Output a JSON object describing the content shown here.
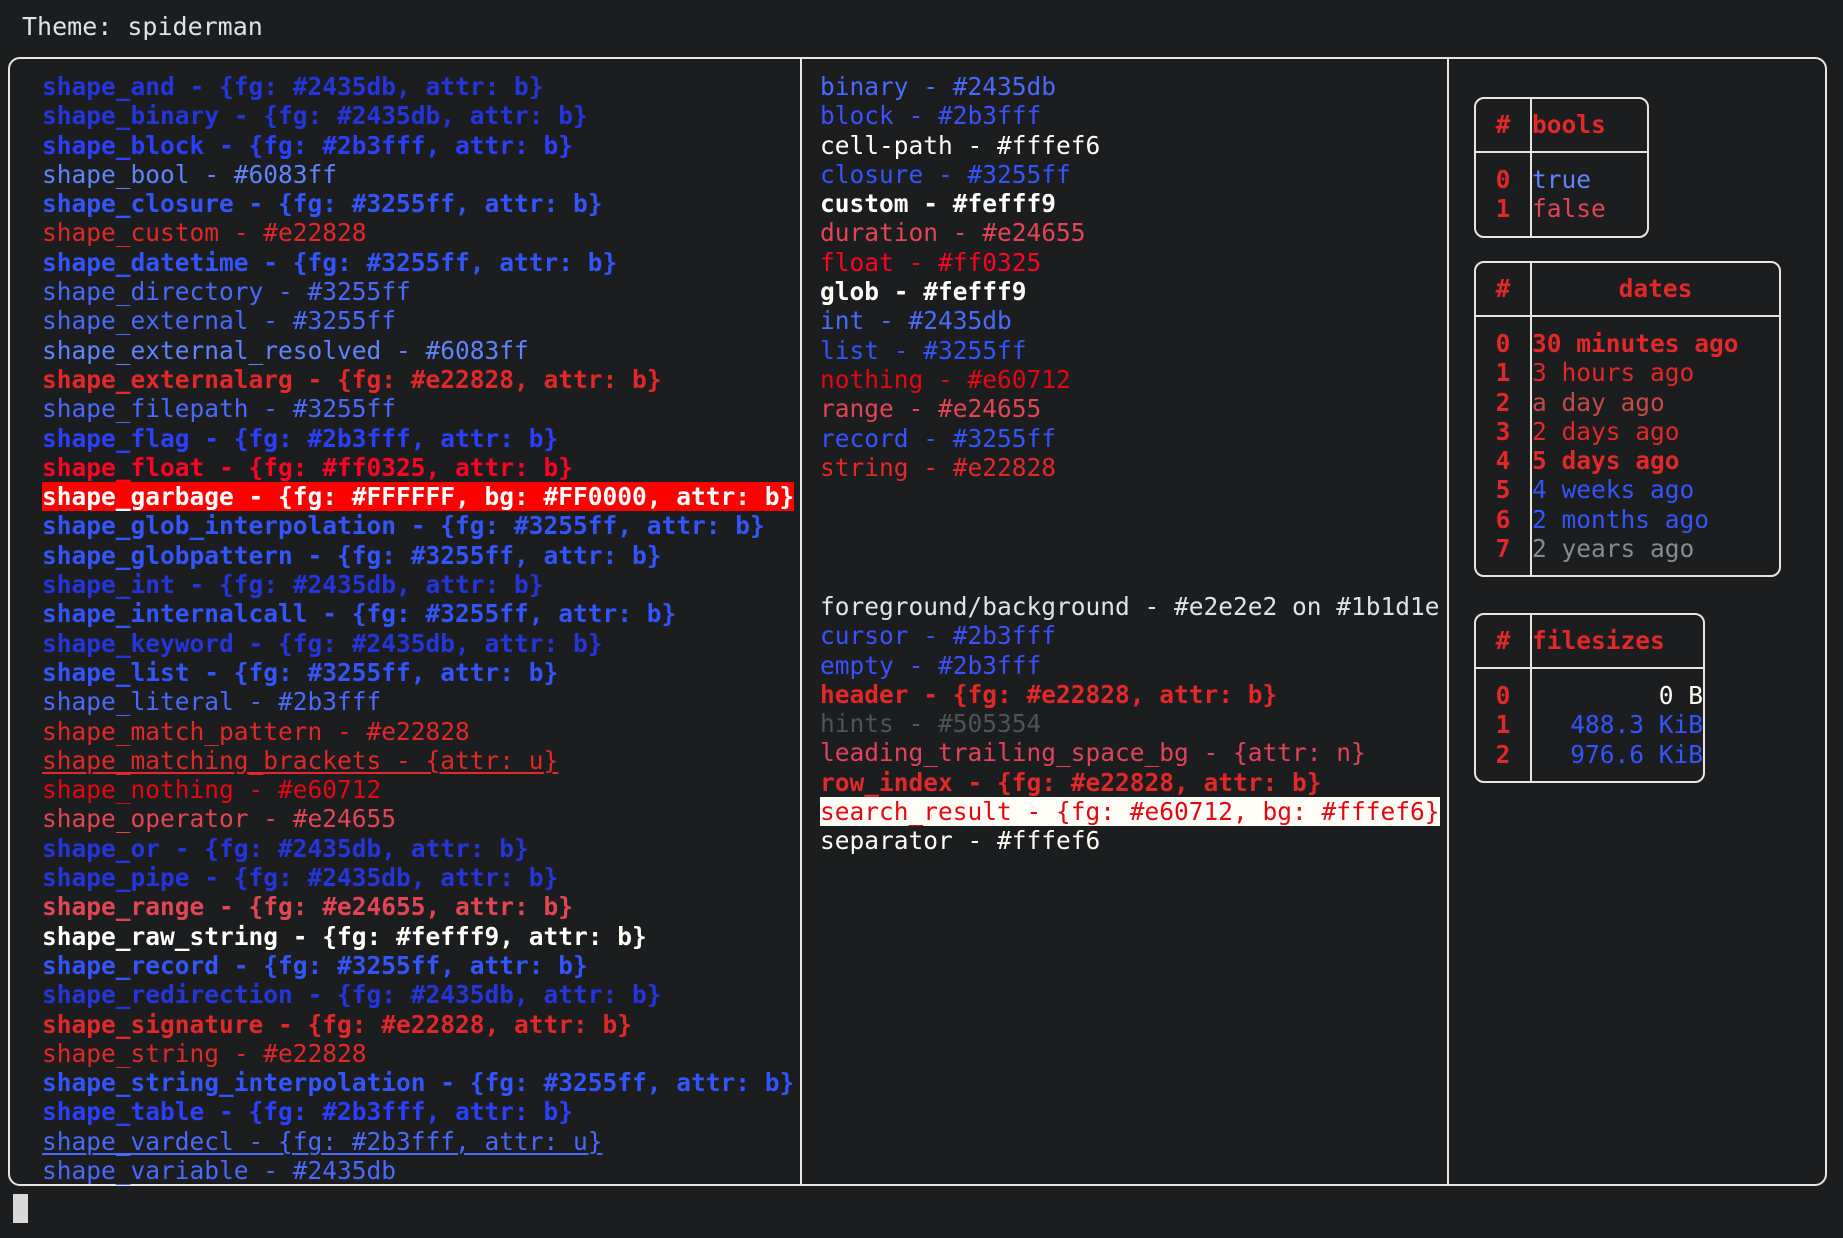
{
  "header": {
    "theme_label": "Theme: spiderman"
  },
  "palette": {
    "background": "#1b1d1e",
    "foreground": "#e2e2e2",
    "border": "#e8e6df",
    "blue_dark": "#2435db",
    "blue_bright": "#2b3fff",
    "blue_mid": "#3255ff",
    "blue_light": "#6083ff",
    "red": "#e22828",
    "red_bright": "#ff0325",
    "red_pure": "#e60712",
    "red_soft": "#e24655",
    "cream": "#fefff9",
    "cream2": "#fffef6",
    "grey": "#505354",
    "highlight_bg": "#ff0000",
    "highlight_fg": "#ffffff"
  },
  "shapes": [
    {
      "text": "shape_and - {fg: #2435db, attr: b}",
      "fg": "#2435db",
      "bold": true,
      "underline": false
    },
    {
      "text": "shape_binary - {fg: #2435db, attr: b}",
      "fg": "#2435db",
      "bold": true,
      "underline": false
    },
    {
      "text": "shape_block - {fg: #2b3fff, attr: b}",
      "fg": "#2b3fff",
      "bold": true,
      "underline": false
    },
    {
      "text": "shape_bool - #6083ff",
      "fg": "#6083ff",
      "bold": false,
      "underline": false
    },
    {
      "text": "shape_closure - {fg: #3255ff, attr: b}",
      "fg": "#3255ff",
      "bold": true,
      "underline": false
    },
    {
      "text": "shape_custom - #e22828",
      "fg": "#e22828",
      "bold": false,
      "underline": false
    },
    {
      "text": "shape_datetime - {fg: #3255ff, attr: b}",
      "fg": "#3255ff",
      "bold": true,
      "underline": false
    },
    {
      "text": "shape_directory - #3255ff",
      "fg": "#4a6aff",
      "bold": false,
      "underline": false
    },
    {
      "text": "shape_external - #3255ff",
      "fg": "#4a6aff",
      "bold": false,
      "underline": false
    },
    {
      "text": "shape_external_resolved - #6083ff",
      "fg": "#6083ff",
      "bold": false,
      "underline": false
    },
    {
      "text": "shape_externalarg - {fg: #e22828, attr: b}",
      "fg": "#e22828",
      "bold": true,
      "underline": false
    },
    {
      "text": "shape_filepath - #3255ff",
      "fg": "#4a6aff",
      "bold": false,
      "underline": false
    },
    {
      "text": "shape_flag - {fg: #2b3fff, attr: b}",
      "fg": "#2b3fff",
      "bold": true,
      "underline": false
    },
    {
      "text": "shape_float - {fg: #ff0325, attr: b}",
      "fg": "#ff0325",
      "bold": true,
      "underline": false
    },
    {
      "text": "shape_garbage - {fg: #FFFFFF, bg: #FF0000, attr: b}",
      "fg": "#ffffff",
      "bg": "#ff0000",
      "bold": true,
      "underline": false
    },
    {
      "text": "shape_glob_interpolation - {fg: #3255ff, attr: b}",
      "fg": "#3255ff",
      "bold": true,
      "underline": false
    },
    {
      "text": "shape_globpattern - {fg: #3255ff, attr: b}",
      "fg": "#3255ff",
      "bold": true,
      "underline": false
    },
    {
      "text": "shape_int - {fg: #2435db, attr: b}",
      "fg": "#2435db",
      "bold": true,
      "underline": false
    },
    {
      "text": "shape_internalcall - {fg: #3255ff, attr: b}",
      "fg": "#3255ff",
      "bold": true,
      "underline": false
    },
    {
      "text": "shape_keyword - {fg: #2435db, attr: b}",
      "fg": "#2435db",
      "bold": true,
      "underline": false
    },
    {
      "text": "shape_list - {fg: #3255ff, attr: b}",
      "fg": "#3255ff",
      "bold": true,
      "underline": false
    },
    {
      "text": "shape_literal - #2b3fff",
      "fg": "#4a6aff",
      "bold": false,
      "underline": false
    },
    {
      "text": "shape_match_pattern - #e22828",
      "fg": "#e22828",
      "bold": false,
      "underline": false
    },
    {
      "text": "shape_matching_brackets - {attr: u}",
      "fg": "#e22828",
      "bold": false,
      "underline": true
    },
    {
      "text": "shape_nothing - #e60712",
      "fg": "#e60712",
      "bold": false,
      "underline": false
    },
    {
      "text": "shape_operator - #e24655",
      "fg": "#e24655",
      "bold": false,
      "underline": false
    },
    {
      "text": "shape_or - {fg: #2435db, attr: b}",
      "fg": "#2435db",
      "bold": true,
      "underline": false
    },
    {
      "text": "shape_pipe - {fg: #2435db, attr: b}",
      "fg": "#2435db",
      "bold": true,
      "underline": false
    },
    {
      "text": "shape_range - {fg: #e24655, attr: b}",
      "fg": "#e24655",
      "bold": true,
      "underline": false
    },
    {
      "text": "shape_raw_string - {fg: #fefff9, attr: b}",
      "fg": "#fefff9",
      "bold": true,
      "underline": false
    },
    {
      "text": "shape_record - {fg: #3255ff, attr: b}",
      "fg": "#3255ff",
      "bold": true,
      "underline": false
    },
    {
      "text": "shape_redirection - {fg: #2435db, attr: b}",
      "fg": "#2435db",
      "bold": true,
      "underline": false
    },
    {
      "text": "shape_signature - {fg: #e22828, attr: b}",
      "fg": "#e22828",
      "bold": true,
      "underline": false
    },
    {
      "text": "shape_string - #e22828",
      "fg": "#e22828",
      "bold": false,
      "underline": false
    },
    {
      "text": "shape_string_interpolation - {fg: #3255ff, attr: b}",
      "fg": "#3255ff",
      "bold": true,
      "underline": false
    },
    {
      "text": "shape_table - {fg: #2b3fff, attr: b}",
      "fg": "#2b3fff",
      "bold": true,
      "underline": false
    },
    {
      "text": "shape_vardecl - {fg: #2b3fff, attr: u}",
      "fg": "#4a6aff",
      "bold": false,
      "underline": true
    },
    {
      "text": "shape_variable - #2435db",
      "fg": "#4a6aff",
      "bold": false,
      "underline": false
    }
  ],
  "types": [
    {
      "text": "binary - #2435db",
      "fg": "#4a6aff",
      "bold": false,
      "underline": false
    },
    {
      "text": "block - #2b3fff",
      "fg": "#3b50ff",
      "bold": false,
      "underline": false
    },
    {
      "text": "cell-path - #fffef6",
      "fg": "#fffef6",
      "bold": false,
      "underline": false
    },
    {
      "text": "closure - #3255ff",
      "fg": "#3255ff",
      "bold": false,
      "underline": false
    },
    {
      "text": "custom - #fefff9",
      "fg": "#fefff9",
      "bold": true,
      "underline": false
    },
    {
      "text": "duration - #e24655",
      "fg": "#e24655",
      "bold": false,
      "underline": false
    },
    {
      "text": "float - #ff0325",
      "fg": "#ff0325",
      "bold": false,
      "underline": false
    },
    {
      "text": "glob - #fefff9",
      "fg": "#fefff9",
      "bold": true,
      "underline": false
    },
    {
      "text": "int - #2435db",
      "fg": "#4a6aff",
      "bold": false,
      "underline": false
    },
    {
      "text": "list - #3255ff",
      "fg": "#3255ff",
      "bold": false,
      "underline": false
    },
    {
      "text": "nothing - #e60712",
      "fg": "#e60712",
      "bold": false,
      "underline": false
    },
    {
      "text": "range - #e24655",
      "fg": "#e24655",
      "bold": false,
      "underline": false
    },
    {
      "text": "record - #3255ff",
      "fg": "#3255ff",
      "bold": false,
      "underline": false
    },
    {
      "text": "string - #e22828",
      "fg": "#e22828",
      "bold": false,
      "underline": false
    }
  ],
  "ui_elements": [
    {
      "text": "foreground/background - #e2e2e2 on #1b1d1e",
      "fg": "#e2e2e2",
      "bold": false,
      "underline": false
    },
    {
      "text": "cursor - #2b3fff",
      "fg": "#3b50ff",
      "bold": false,
      "underline": false
    },
    {
      "text": "empty - #2b3fff",
      "fg": "#3b50ff",
      "bold": false,
      "underline": false
    },
    {
      "text": "header - {fg: #e22828, attr: b}",
      "fg": "#e22828",
      "bold": true,
      "underline": false
    },
    {
      "text": "hints - #505354",
      "fg": "#505354",
      "bold": false,
      "underline": false
    },
    {
      "text": "leading_trailing_space_bg - {attr: n}",
      "fg": "#e2435a",
      "bold": false,
      "underline": false
    },
    {
      "text": "row_index - {fg: #e22828, attr: b}",
      "fg": "#e22828",
      "bold": true,
      "underline": false
    },
    {
      "text": "search_result - {fg: #e60712, bg: #fffef6}",
      "fg": "#e60712",
      "bg": "#fffef6",
      "bold": false,
      "underline": false
    },
    {
      "text": "separator - #fffef6",
      "fg": "#fffef6",
      "bold": false,
      "underline": false
    }
  ],
  "tables": {
    "bools": {
      "columns": [
        "#",
        "bools"
      ],
      "rows": [
        {
          "index": "0",
          "value": "true",
          "fg": "#6083ff",
          "bold": false
        },
        {
          "index": "1",
          "value": "false",
          "fg": "#e24655",
          "bold": false
        }
      ]
    },
    "dates": {
      "columns": [
        "#",
        "dates"
      ],
      "rows": [
        {
          "index": "0",
          "value": "30 minutes ago",
          "fg": "#e22828",
          "bold": true
        },
        {
          "index": "1",
          "value": "3 hours ago",
          "fg": "#e22828",
          "bold": false
        },
        {
          "index": "2",
          "value": "a day ago",
          "fg": "#c44a4a",
          "bold": false
        },
        {
          "index": "3",
          "value": "2 days ago",
          "fg": "#e22828",
          "bold": false
        },
        {
          "index": "4",
          "value": "5 days ago",
          "fg": "#e22828",
          "bold": true
        },
        {
          "index": "5",
          "value": "4 weeks ago",
          "fg": "#3255ff",
          "bold": false
        },
        {
          "index": "6",
          "value": "2 months ago",
          "fg": "#3255ff",
          "bold": false
        },
        {
          "index": "7",
          "value": "2 years ago",
          "fg": "#8a8a8a",
          "bold": false
        }
      ]
    },
    "filesizes": {
      "columns": [
        "#",
        "filesizes"
      ],
      "rows": [
        {
          "index": "0",
          "value": "0 B",
          "fg": "#fffef6",
          "bold": false
        },
        {
          "index": "1",
          "value": "488.3 KiB",
          "fg": "#3255ff",
          "bold": false
        },
        {
          "index": "2",
          "value": "976.6 KiB",
          "fg": "#3255ff",
          "bold": false
        }
      ]
    }
  },
  "prompt": {
    "cursor": "block-cursor"
  }
}
